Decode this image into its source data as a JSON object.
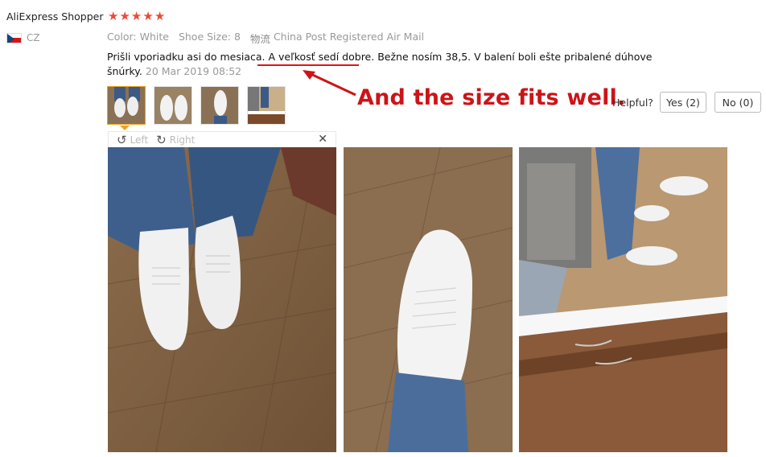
{
  "reviewer": {
    "name": "AliExpress Shopper",
    "rating": 5,
    "country_code": "CZ"
  },
  "meta": {
    "color": "Color: White",
    "shoe_size": "Shoe Size: 8",
    "logistics_prefix": "物流",
    "logistics": "China Post Registered Air Mail"
  },
  "review": {
    "text_before": "Prišli vporiadku asi do mesiaca. ",
    "text_highlight": "A veľkosť sedí dobre.",
    "text_after": " Bežne nosím 38,5. V balení boli ešte pribalené dúhove šnúrky.",
    "date": "20 Mar 2019 08:52"
  },
  "annotation": {
    "text": "And the size fits well.",
    "color": "#cc1418"
  },
  "helpful": {
    "label": "Helpful?",
    "yes_label": "Yes (2)",
    "no_label": "No (0)"
  },
  "viewer": {
    "left_label": "Left",
    "right_label": "Right",
    "close_icon": "close-icon"
  },
  "thumbnails": [
    "photo-1",
    "photo-2",
    "photo-3",
    "photo-4"
  ],
  "colors": {
    "star": "#e74c3c",
    "accent_underline": "#e0141a",
    "active_thumb_border": "#f0a020"
  }
}
